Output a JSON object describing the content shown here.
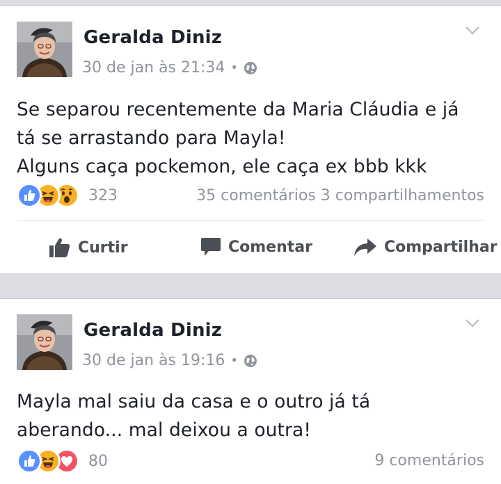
{
  "posts": [
    {
      "author": "Geralda Diniz",
      "time": "30 de jan às 21:34",
      "separator": "•",
      "privacy_icon": "globe-icon",
      "text_lines": [
        "Se separou recentemente da Maria Cláudia e já",
        "tá se arrastando para Mayla!",
        "Alguns caça pockemon, ele caça ex bbb kkk"
      ],
      "reactions": [
        "like",
        "haha",
        "wow"
      ],
      "reaction_count": "323",
      "stats": "35 comentários 3 compartilhamentos",
      "actions": {
        "like": "Curtir",
        "comment": "Comentar",
        "share": "Compartilhar"
      }
    },
    {
      "author": "Geralda Diniz",
      "time": "30 de jan às 19:16",
      "separator": "•",
      "privacy_icon": "globe-icon",
      "text_lines": [
        "Mayla mal saiu da casa e o outro já tá",
        "aberando... mal deixou a outra!"
      ],
      "reactions": [
        "like",
        "haha",
        "love"
      ],
      "reaction_count": "80",
      "stats": "9 comentários"
    }
  ],
  "colors": {
    "like_blue": "#5890ff",
    "haha_yellow": "#f7b125",
    "love_red": "#f25268",
    "meta_gray": "#90949c",
    "feed_bg": "#dcdee3"
  }
}
